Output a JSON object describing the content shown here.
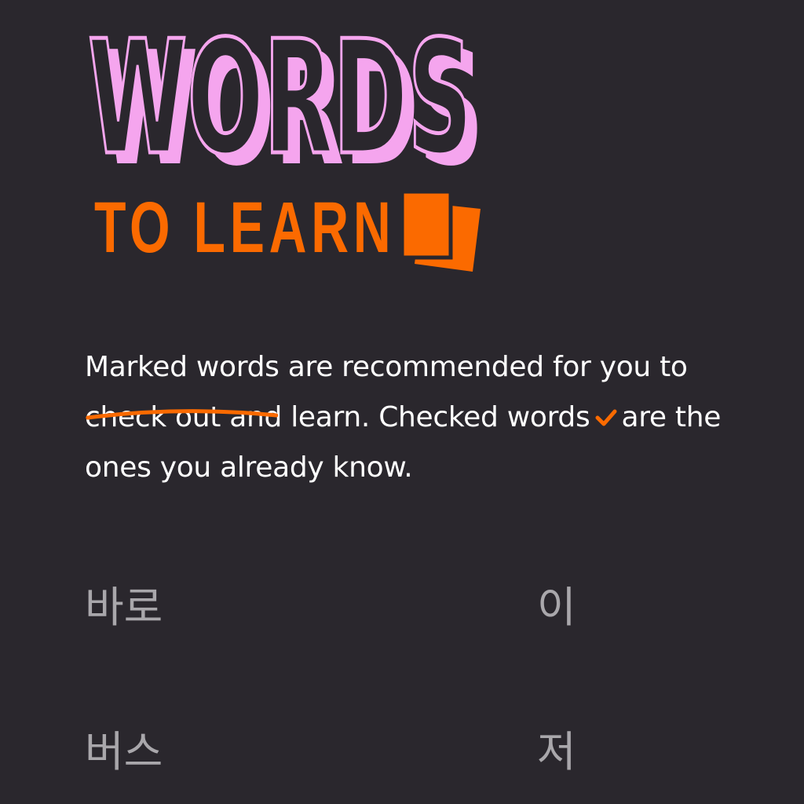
{
  "logo": {
    "title": "WORDS",
    "subtitle": "TO LEARN",
    "icon": "flashcards-icon"
  },
  "intro": {
    "marked_phrase": "Marked words",
    "text_after_marked": " are recommended for you to check out and learn. Checked words",
    "text_after_check": "are the ones you already know."
  },
  "words": [
    {
      "text": "바로"
    },
    {
      "text": "이"
    },
    {
      "text": "버스"
    },
    {
      "text": "저"
    }
  ],
  "colors": {
    "background": "#2a272d",
    "accent_orange": "#fb6a00",
    "logo_pink": "#f5a5ee",
    "word_gray": "#a9a7ab",
    "text_white": "#ffffff"
  }
}
